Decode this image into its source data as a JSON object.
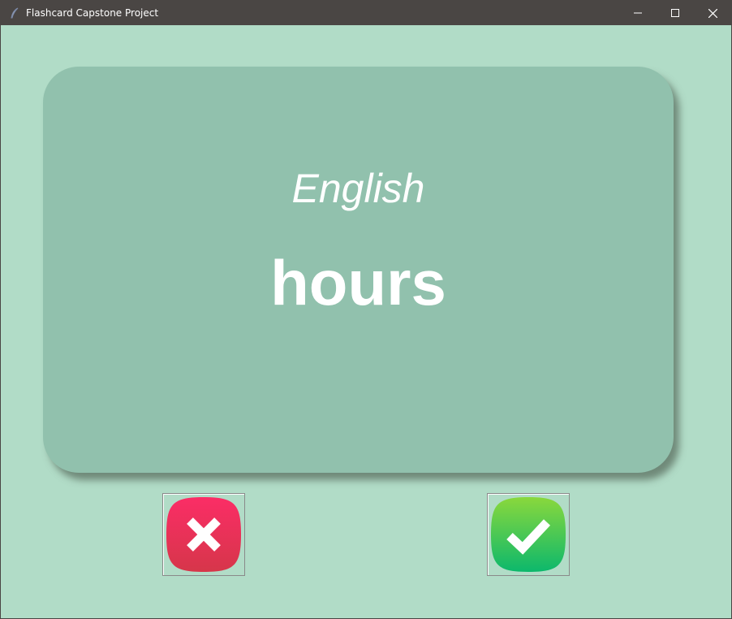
{
  "window": {
    "title": "Flashcard Capstone Project",
    "controls": [
      "minimize-icon",
      "maximize-icon",
      "close-icon"
    ]
  },
  "card": {
    "title": "English",
    "word": "hours",
    "background": "#91c1ad"
  },
  "buttons": {
    "wrong": {
      "icon": "cross-icon",
      "color": "#e8305a"
    },
    "right": {
      "icon": "check-icon",
      "color": "#22bf5c"
    }
  },
  "colors": {
    "background": "#b1dcc7",
    "titlebar": "#4a4644"
  }
}
